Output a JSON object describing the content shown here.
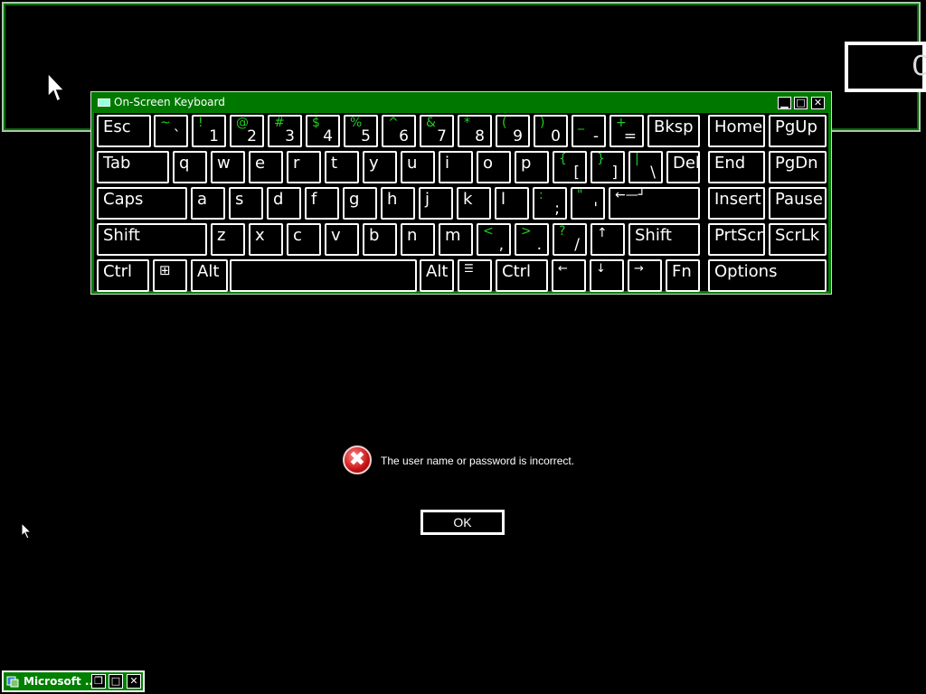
{
  "background_window": {
    "glyph": "C"
  },
  "osk": {
    "title": "On-Screen Keyboard",
    "title_buttons": {
      "minimize": "▁",
      "maximize": "□",
      "close": "✕"
    },
    "keys": {
      "esc": "Esc",
      "backquote": {
        "top": "~",
        "bottom": "`"
      },
      "d1": {
        "top": "!",
        "bottom": "1"
      },
      "d2": {
        "top": "@",
        "bottom": "2"
      },
      "d3": {
        "top": "#",
        "bottom": "3"
      },
      "d4": {
        "top": "$",
        "bottom": "4"
      },
      "d5": {
        "top": "%",
        "bottom": "5"
      },
      "d6": {
        "top": "^",
        "bottom": "6"
      },
      "d7": {
        "top": "&",
        "bottom": "7"
      },
      "d8": {
        "top": "*",
        "bottom": "8"
      },
      "d9": {
        "top": "(",
        "bottom": "9"
      },
      "d0": {
        "top": ")",
        "bottom": "0"
      },
      "minus": {
        "top": "_",
        "bottom": "-"
      },
      "equals": {
        "top": "+",
        "bottom": "="
      },
      "bksp": "Bksp",
      "home": "Home",
      "pgup": "PgUp",
      "tab": "Tab",
      "q": "q",
      "w": "w",
      "e": "e",
      "r": "r",
      "t": "t",
      "y": "y",
      "u": "u",
      "i": "i",
      "o": "o",
      "p": "p",
      "lbracket": {
        "top": "{",
        "bottom": "["
      },
      "rbracket": {
        "top": "}",
        "bottom": "]"
      },
      "backslash": {
        "top": "|",
        "bottom": "\\"
      },
      "del": "Del",
      "end": "End",
      "pgdn": "PgDn",
      "caps": "Caps",
      "a": "a",
      "s": "s",
      "d": "d",
      "f": "f",
      "g": "g",
      "h": "h",
      "j": "j",
      "k": "k",
      "l": "l",
      "semicolon": {
        "top": ":",
        "bottom": ";"
      },
      "quote": {
        "top": "\"",
        "bottom": "'"
      },
      "enter": "←—┘",
      "insert": "Insert",
      "pause": "Pause",
      "lshift": "Shift",
      "z": "z",
      "x": "x",
      "c": "c",
      "v": "v",
      "b": "b",
      "n": "n",
      "m": "m",
      "comma": {
        "top": "<",
        "bottom": ","
      },
      "period": {
        "top": ">",
        "bottom": "."
      },
      "slash": {
        "top": "?",
        "bottom": "/"
      },
      "up": "↑",
      "rshift": "Shift",
      "prtscn": "PrtScn",
      "scrlk": "ScrLk",
      "lctrl": "Ctrl",
      "win": "⊞",
      "lalt": "Alt",
      "space": "",
      "ralt": "Alt",
      "menu": "☰",
      "rctrl": "Ctrl",
      "left": "←",
      "down": "↓",
      "right": "→",
      "fn": "Fn",
      "options": "Options"
    }
  },
  "dialog": {
    "icon": "✖",
    "message": "The user name or password is incorrect.",
    "ok_label": "OK"
  },
  "taskbar_window": {
    "title": "Microsoft ...",
    "buttons": {
      "restore": "❐",
      "maximize": "□",
      "close": "✕"
    }
  }
}
